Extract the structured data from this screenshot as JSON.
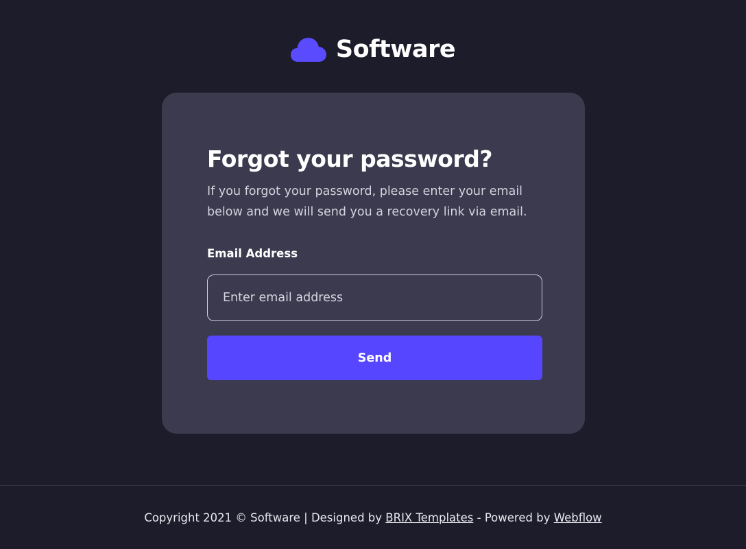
{
  "brand": {
    "name": "Software",
    "icon": "cloud-icon",
    "accent_color": "#5646ff"
  },
  "card": {
    "title": "Forgot your password?",
    "description": "If you forgot your password, please enter your email below and we will send you a recovery link via email.",
    "email_label": "Email Address",
    "email_placeholder": "Enter email address",
    "email_value": "",
    "send_label": "Send"
  },
  "footer": {
    "copyright": "Copyright 2021 © Software | Designed by",
    "brix_link": "BRIX Templates",
    "powered_text": "- Powered by",
    "webflow_link": "Webflow"
  },
  "colors": {
    "background": "#1d1c2a",
    "card": "#3b3a4e",
    "button": "#5646ff"
  }
}
